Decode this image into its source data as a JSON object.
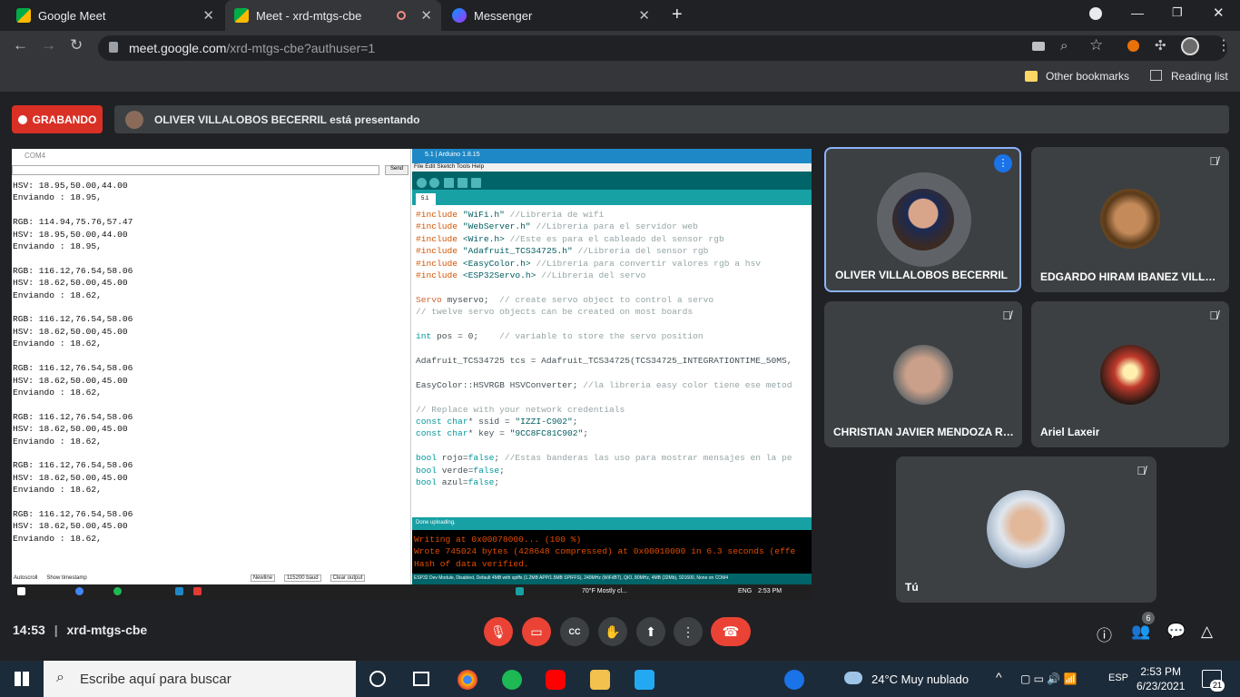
{
  "browser": {
    "tabs": [
      {
        "title": "Google Meet"
      },
      {
        "title": "Meet - xrd-mtgs-cbe"
      },
      {
        "title": "Messenger"
      }
    ],
    "url_domain": "meet.google.com",
    "url_path": "/xrd-mtgs-cbe?authuser=1",
    "bookmarks": {
      "other": "Other bookmarks",
      "reading": "Reading list"
    }
  },
  "meet": {
    "recording_label": "GRABANDO",
    "presenting_text": "OLIVER VILLALOBOS BECERRIL está presentando",
    "time": "14:53",
    "meeting_code": "xrd-mtgs-cbe",
    "participant_count": "6",
    "participants": [
      {
        "name": "OLIVER VILLALOBOS BECERRIL"
      },
      {
        "name": "EDGARDO HIRAM IBANEZ VILLALO..."
      },
      {
        "name": "CHRISTIAN JAVIER MENDOZA RAM..."
      },
      {
        "name": "Ariel Laxeir"
      },
      {
        "name": "Tú"
      }
    ]
  },
  "shared_screen": {
    "serial": {
      "title": "COM4",
      "send_label": "Send",
      "output": "HSV: 18.95,50.00,44.00\nEnviando : 18.95,\n\nRGB: 114.94,75.76,57.47\nHSV: 18.95,50.00,44.00\nEnviando : 18.95,\n\nRGB: 116.12,76.54,58.06\nHSV: 18.62,50.00,45.00\nEnviando : 18.62,\n\nRGB: 116.12,76.54,58.06\nHSV: 18.62,50.00,45.00\nEnviando : 18.62,\n\nRGB: 116.12,76.54,58.06\nHSV: 18.62,50.00,45.00\nEnviando : 18.62,\n\nRGB: 116.12,76.54,58.06\nHSV: 18.62,50.00,45.00\nEnviando : 18.62,\n\nRGB: 116.12,76.54,58.06\nHSV: 18.62,50.00,45.00\nEnviando : 18.62,\n\nRGB: 116.12,76.54,58.06\nHSV: 18.62,50.00,45.00\nEnviando : 18.62,",
      "autoscroll": "Autoscroll",
      "timestamp": "Show timestamp",
      "newline": "Newline",
      "baud": "115200 baud",
      "clear": "Clear output"
    },
    "arduino": {
      "title": "5.1 | Arduino 1.8.15",
      "menu": "File Edit Sketch Tools Help",
      "tab": "5.1",
      "status": "Done uploading.",
      "console": "Writing at 0x00078000... (100 %)\nWrote 745024 bytes (428648 compressed) at 0x00010000 in 6.3 seconds (effe\nHash of data verified.",
      "footer": "ESP32 Dev Module, Disabled, Default 4MB with spiffs (1.2MB APP/1.5MB SPIFFS), 240MHz (WiFi/BT), QIO, 80MHz, 4MB (32Mb), 921600, None on COM4"
    },
    "win_weather": "70°F  Mostly cl...",
    "win_lang": "ENG",
    "win_time": "2:53 PM"
  },
  "taskbar": {
    "search_placeholder": "Escribe aquí para buscar",
    "weather": "24°C  Muy nublado",
    "lang": "ESP",
    "time": "2:53 PM",
    "date": "6/23/2021",
    "notif_count": "21"
  }
}
